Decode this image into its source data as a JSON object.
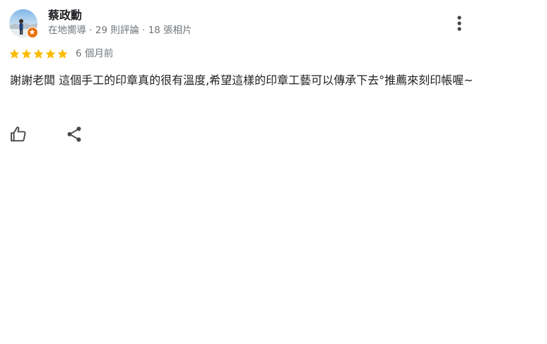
{
  "reviewer": {
    "name": "蔡政勳",
    "meta": "在地嚮導 · 29 則評論 · 18 張相片",
    "avatar_icon": "user-profile-photo",
    "badge_icon": "local-guide-badge-icon",
    "badge_color": "#e8710a"
  },
  "rating": {
    "stars": 5,
    "max": 5,
    "star_color": "#fbbc04",
    "date": "6 個月前"
  },
  "review": {
    "text": "謝謝老闆 這個手工的印章真的很有溫度,希望這樣的印章工藝可以傳承下去°推薦來刻印帳喔~"
  },
  "actions": {
    "like_icon": "thumb-up-icon",
    "share_icon": "share-icon",
    "more_icon": "more-vert-icon"
  }
}
